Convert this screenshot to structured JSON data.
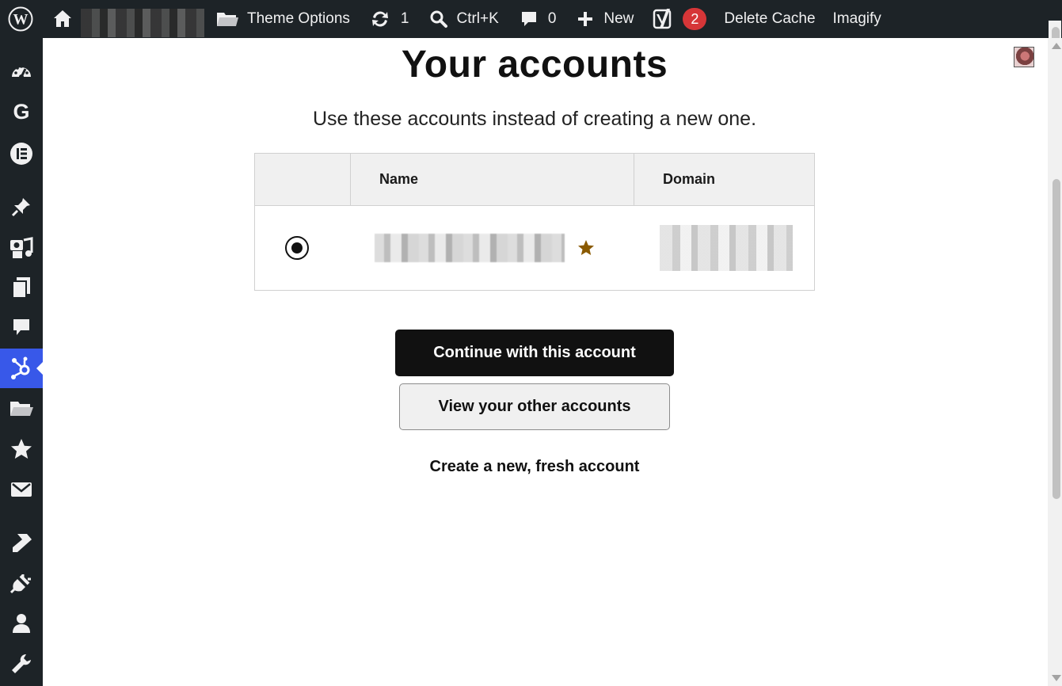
{
  "admin_bar": {
    "theme_options": "Theme Options",
    "updates_count": "1",
    "search_shortcut": "Ctrl+K",
    "comments_count": "0",
    "new_label": "New",
    "yoast_badge": "2",
    "delete_cache": "Delete Cache",
    "imagify": "Imagify"
  },
  "sidebar": {
    "items": [
      {
        "icon": "dashboard-icon"
      },
      {
        "icon": "google-icon"
      },
      {
        "icon": "elementor-icon"
      },
      {
        "icon": "pin-icon"
      },
      {
        "icon": "media-icon"
      },
      {
        "icon": "pages-icon"
      },
      {
        "icon": "comments-icon"
      },
      {
        "icon": "hubspot-icon",
        "active": true
      },
      {
        "icon": "folder-icon"
      },
      {
        "icon": "star-icon"
      },
      {
        "icon": "mail-icon"
      },
      {
        "icon": "appearance-icon"
      },
      {
        "icon": "plugins-icon"
      },
      {
        "icon": "users-icon"
      },
      {
        "icon": "tools-icon"
      }
    ]
  },
  "main": {
    "heading": "Your accounts",
    "subtitle": "Use these accounts instead of creating a new one.",
    "table": {
      "headers": [
        "",
        "Name",
        "Domain"
      ],
      "rows": [
        {
          "selected": true,
          "name": "",
          "domain": "",
          "starred": true
        }
      ]
    },
    "primary_button": "Continue with this account",
    "secondary_button": "View your other accounts",
    "create_link": "Create a new, fresh account"
  },
  "colors": {
    "admin_bar_bg": "#1d2327",
    "active_menu": "#3858e9",
    "badge": "#d63638",
    "star": "#8a5a00",
    "primary_button_bg": "#111111"
  }
}
